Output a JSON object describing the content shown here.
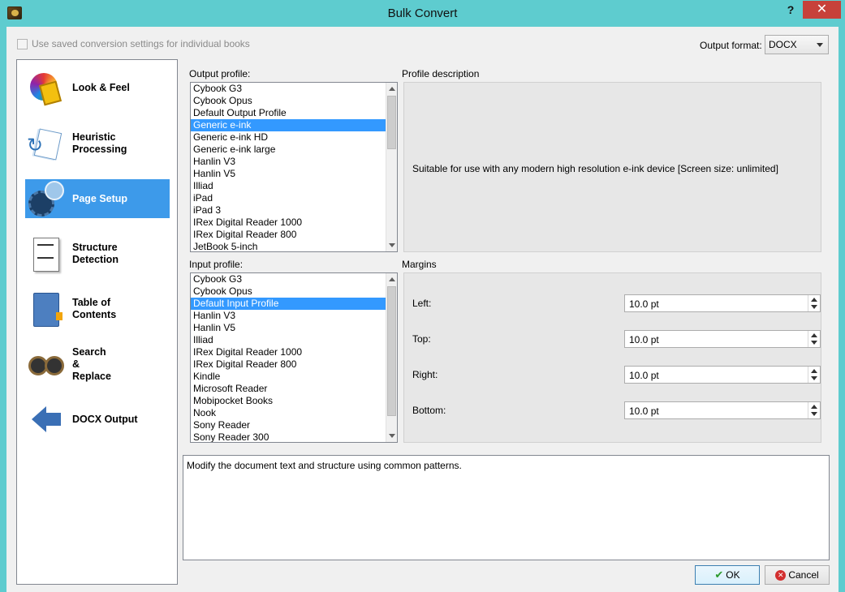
{
  "window": {
    "title": "Bulk Convert",
    "help_glyph": "?"
  },
  "top": {
    "saved_settings_label": "Use saved conversion settings for individual books",
    "output_format_label": "Output format:",
    "output_format_value": "DOCX"
  },
  "nav": {
    "items": [
      {
        "label": "Look & Feel",
        "icon": "look-and-feel-icon"
      },
      {
        "label": "Heuristic\nProcessing",
        "icon": "heuristic-processing-icon"
      },
      {
        "label": "Page Setup",
        "icon": "page-setup-icon",
        "active": true
      },
      {
        "label": "Structure\nDetection",
        "icon": "structure-detection-icon"
      },
      {
        "label": "Table of\nContents",
        "icon": "table-of-contents-icon"
      },
      {
        "label": "Search\n&\nReplace",
        "icon": "search-replace-icon"
      },
      {
        "label": "DOCX Output",
        "icon": "docx-output-icon"
      }
    ]
  },
  "output_profile": {
    "label": "Output profile:",
    "selected": "Generic e-ink",
    "items": [
      "Cybook G3",
      "Cybook Opus",
      "Default Output Profile",
      "Generic e-ink",
      "Generic e-ink HD",
      "Generic e-ink large",
      "Hanlin V3",
      "Hanlin V5",
      "Illiad",
      "iPad",
      "iPad 3",
      "IRex Digital Reader 1000",
      "IRex Digital Reader 800",
      "JetBook 5-inch"
    ]
  },
  "profile_description": {
    "label": "Profile description",
    "text": "Suitable for use with any modern high resolution e-ink device [Screen size: unlimited]"
  },
  "input_profile": {
    "label": "Input profile:",
    "selected": "Default Input Profile",
    "items": [
      "Cybook G3",
      "Cybook Opus",
      "Default Input Profile",
      "Hanlin V3",
      "Hanlin V5",
      "Illiad",
      "IRex Digital Reader 1000",
      "IRex Digital Reader 800",
      "Kindle",
      "Microsoft Reader",
      "Mobipocket Books",
      "Nook",
      "Sony Reader",
      "Sony Reader 300"
    ]
  },
  "margins": {
    "label": "Margins",
    "left_label": "Left:",
    "left_value": "10.0 pt",
    "top_label": "Top:",
    "top_value": "10.0 pt",
    "right_label": "Right:",
    "right_value": "10.0 pt",
    "bottom_label": "Bottom:",
    "bottom_value": "10.0 pt"
  },
  "help_text": "Modify the document text and structure using common patterns.",
  "buttons": {
    "ok": "OK",
    "cancel": "Cancel"
  },
  "colors": {
    "titlebar": "#5ecccf",
    "selection": "#3399ff",
    "nav_active": "#3d9aea",
    "close": "#c7413a"
  }
}
